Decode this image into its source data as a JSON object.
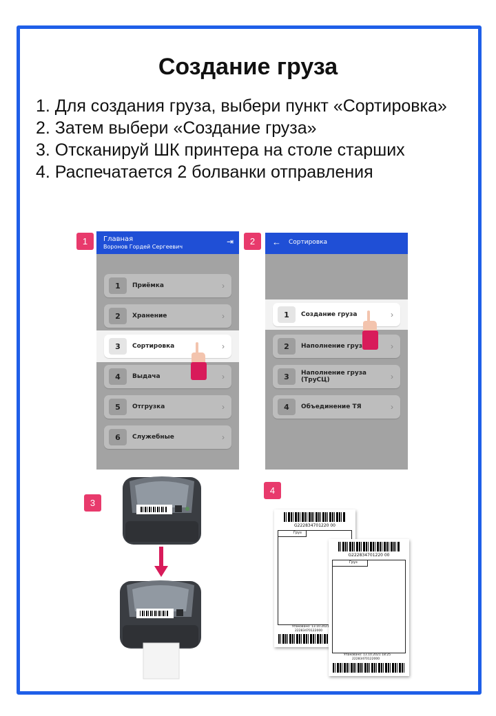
{
  "title": "Создание груза",
  "steps": [
    "1. Для создания груза, выбери пункт «Сортировка»",
    "2. Затем выбери «Создание груза»",
    "3. Отсканируй ШК принтера на столе старших",
    "4. Распечатается 2 болванки отправления"
  ],
  "badges": [
    "1",
    "2",
    "3",
    "4"
  ],
  "screen1": {
    "header_title": "Главная",
    "header_user": "Воронов Гордей Сергеевич",
    "items": [
      {
        "num": "1",
        "label": "Приёмка"
      },
      {
        "num": "2",
        "label": "Хранение"
      },
      {
        "num": "3",
        "label": "Сортировка"
      },
      {
        "num": "4",
        "label": "Выдача"
      },
      {
        "num": "5",
        "label": "Отгрузка"
      },
      {
        "num": "6",
        "label": "Служебные"
      }
    ]
  },
  "screen2": {
    "header_title": "Сортировка",
    "items": [
      {
        "num": "1",
        "label": "Создание груза"
      },
      {
        "num": "2",
        "label": "Наполнение груза"
      },
      {
        "num": "3",
        "label": "Наполнение груза (ТруСЦ)"
      },
      {
        "num": "4",
        "label": "Объединение ТЯ"
      }
    ]
  },
  "labels": [
    {
      "code": "G222834701220 00",
      "gruz": "Груз",
      "pack": "Упаковано: 13.10.2021",
      "code2": "22283470122000"
    },
    {
      "code": "G222834701220 00",
      "gruz": "Груз",
      "pack": "Упаковано: 13.10.2021 18:25",
      "code2": "22283470122000"
    }
  ],
  "colors": {
    "frame": "#1f5fe8",
    "header": "#1f4fd6",
    "badge": "#e83a6c",
    "accent": "#d81b5a"
  }
}
